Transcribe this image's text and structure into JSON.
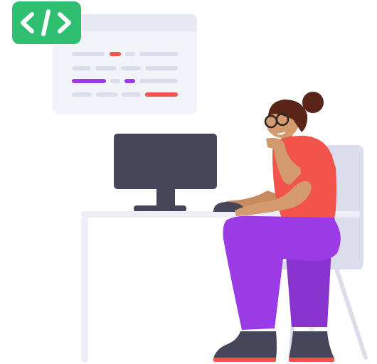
{
  "illustration": {
    "subject": "developer-at-desk-illustration",
    "code_badge": {
      "icon": "code-brackets-icon",
      "glyph": "</>",
      "color": "#2FBF71"
    },
    "code_window": {
      "icon": "code-editor-window-icon",
      "lines": [
        {
          "segments": [
            "text",
            "highlight",
            "text",
            "text"
          ]
        },
        {
          "segments": [
            "text",
            "text",
            "text",
            "text"
          ]
        },
        {
          "segments": [
            "accent",
            "text",
            "accent",
            "text"
          ]
        },
        {
          "segments": [
            "text",
            "text",
            "text",
            "highlight"
          ]
        }
      ]
    },
    "colors": {
      "badge": "#2FBF71",
      "window": "#F2F3F9",
      "window_bar": "#E6E8F3",
      "code_line": "#DADDEB",
      "highlight": "#F2544B",
      "accent": "#9B3BE5",
      "monitor": "#454659",
      "desk": "#EDEEF6",
      "chair": "#DCDDEC",
      "shirt": "#F2544B",
      "pants": "#9B3BE5",
      "skin": "#D39A6E",
      "hair": "#5A2518",
      "shoes": "#454659"
    }
  }
}
